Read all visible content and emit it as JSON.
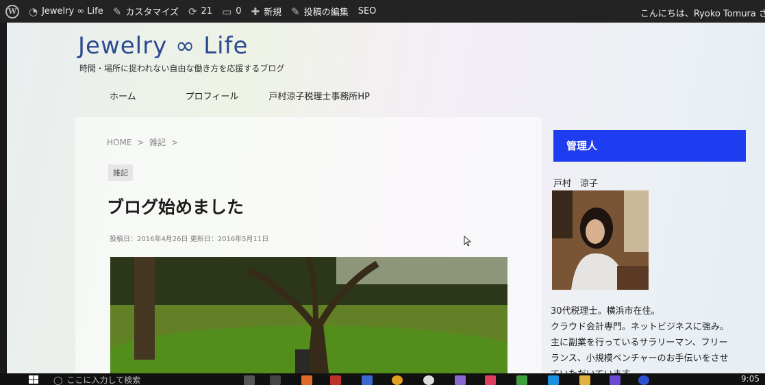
{
  "adminbar": {
    "site_name": "Jewelry ∞ Life",
    "customize": "カスタマイズ",
    "updates_count": "21",
    "comments_count": "0",
    "new": "新規",
    "edit_post": "投稿の編集",
    "seo": "SEO",
    "greeting": "こんにちは、Ryoko Tomura さ"
  },
  "site": {
    "title": "Jewelry ∞ Life",
    "description": "時間・場所に捉われない自由な働き方を応援するブログ",
    "nav": [
      "ホーム",
      "プロフィール",
      "戸村涼子税理士事務所HP"
    ]
  },
  "post": {
    "breadcrumb": [
      "HOME",
      ">",
      "雑記",
      ">"
    ],
    "category": "雑記",
    "title": "ブログ始めました",
    "meta": "投稿日：2016年4月26日 更新日：2016年5月11日"
  },
  "sidebar": {
    "heading": "管理人",
    "author_name": "戸村　涼子",
    "bio": [
      "30代税理士。横浜市在住。",
      "クラウド会計専門。ネットビジネスに強み。",
      "主に副業を行っているサラリーマン、フリー",
      "ランス、小規模ベンチャーのお手伝いをさせ",
      "ていただいています。"
    ]
  },
  "taskbar": {
    "search_placeholder": "ここに入力して検索",
    "clock": "9:05"
  },
  "colors": {
    "sidebar_heading_bg": "#1e3cf0",
    "title_color": "#2c4a8f",
    "adminbar_bg": "#232323"
  }
}
